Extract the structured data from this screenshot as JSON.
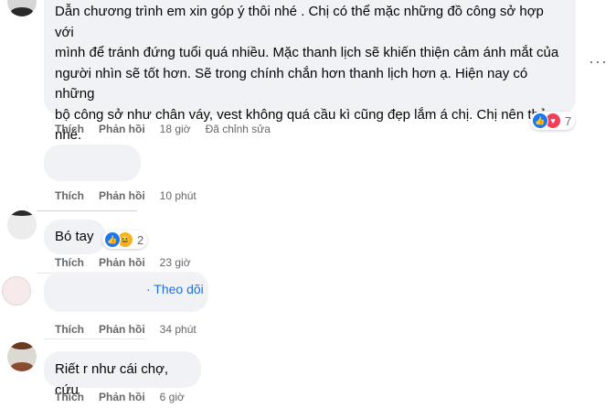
{
  "comments": [
    {
      "text": "Dẫn chương trình em xin góp ý thôi nhé . Chị có thể mặc những đồ công sở hợp với\nmình để tránh đứng tuổi quá nhiều. Mặc thanh lịch sẽ khiến thiện cảm ánh mắt của\nngười nhìn sẽ tốt hơn. Sẽ trong chính chắn hơn thanh lịch hơn ạ. Hiện nay có những\nbộ công sở như chân váy, vest không quá cầu kì cũng đẹp lắm á chị. Chị nên thử\nnhé.",
      "like": "Thích",
      "reply": "Phản hồi",
      "time": "18 giờ",
      "edited": "Đã chỉnh sửa",
      "reaction_count": "7",
      "reaction_icons": [
        "like-icon",
        "love-icon"
      ]
    },
    {
      "text": "",
      "like": "Thích",
      "reply": "Phản hồi",
      "time": "10 phút"
    },
    {
      "text": "Bó tay",
      "like": "Thích",
      "reply": "Phản hồi",
      "time": "23 giờ",
      "reaction_count": "2",
      "reaction_icons": [
        "like-icon",
        "haha-icon"
      ]
    },
    {
      "text": "",
      "follow": "· Theo dõi",
      "like": "Thích",
      "reply": "Phản hồi",
      "time": "34 phút"
    },
    {
      "text": "Riết r như cái chợ, cứu",
      "like": "Thích",
      "reply": "Phản hồi",
      "time": "6 giờ"
    }
  ],
  "colors": {
    "bubble": "#f0f2f5",
    "secondary_text": "#65676b",
    "link": "#216fdb",
    "like_blue": "#1877f2",
    "love_red": "#f33e58",
    "haha_yellow": "#f7b125"
  },
  "more_menu": "···"
}
